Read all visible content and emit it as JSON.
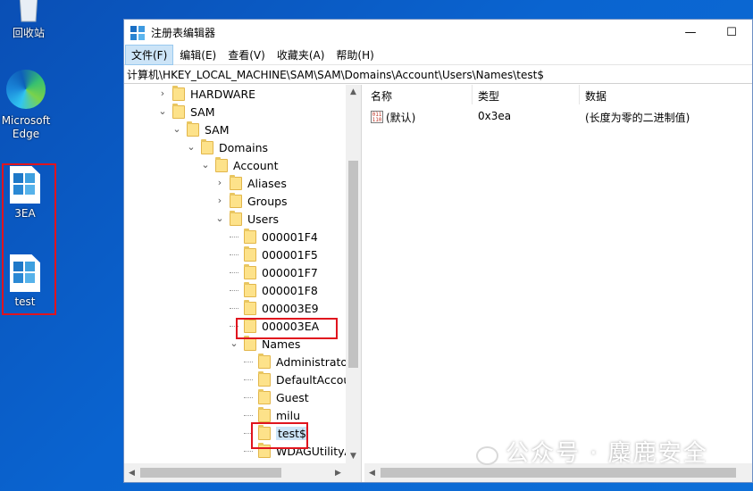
{
  "desktop": {
    "recycle_label": "回收站",
    "edge_label_line1": "Microsoft",
    "edge_label_line2": "Edge",
    "file1_label": "3EA",
    "file2_label": "test"
  },
  "window": {
    "title": "注册表编辑器",
    "minimize_glyph": "—",
    "maximize_glyph": "☐",
    "menu": [
      "文件(F)",
      "编辑(E)",
      "查看(V)",
      "收藏夹(A)",
      "帮助(H)"
    ],
    "address": "计算机\\HKEY_LOCAL_MACHINE\\SAM\\SAM\\Domains\\Account\\Users\\Names\\test$"
  },
  "tree": {
    "nodes": [
      {
        "label": "HARDWARE",
        "expander": ">"
      },
      {
        "label": "SAM",
        "expander": "v"
      },
      {
        "label": "SAM",
        "expander": "v"
      },
      {
        "label": "Domains",
        "expander": "v"
      },
      {
        "label": "Account",
        "expander": "v"
      },
      {
        "label": "Aliases",
        "expander": ">"
      },
      {
        "label": "Groups",
        "expander": ">"
      },
      {
        "label": "Users",
        "expander": "v"
      },
      {
        "label": "000001F4",
        "expander": ""
      },
      {
        "label": "000001F5",
        "expander": ""
      },
      {
        "label": "000001F7",
        "expander": ""
      },
      {
        "label": "000001F8",
        "expander": ""
      },
      {
        "label": "000003E9",
        "expander": ""
      },
      {
        "label": "000003EA",
        "expander": ""
      },
      {
        "label": "Names",
        "expander": "v"
      },
      {
        "label": "Administrator",
        "expander": ""
      },
      {
        "label": "DefaultAccou",
        "expander": ""
      },
      {
        "label": "Guest",
        "expander": ""
      },
      {
        "label": "milu",
        "expander": ""
      },
      {
        "label": "test$",
        "expander": "",
        "selected": true
      },
      {
        "label": "WDAGUtilityA",
        "expander": ""
      }
    ]
  },
  "values": {
    "headers": {
      "name": "名称",
      "type": "类型",
      "data": "数据"
    },
    "rows": [
      {
        "name": "(默认)",
        "type": "0x3ea",
        "data": "(长度为零的二进制值)"
      }
    ]
  },
  "watermark": "公众号 · 麋鹿安全"
}
